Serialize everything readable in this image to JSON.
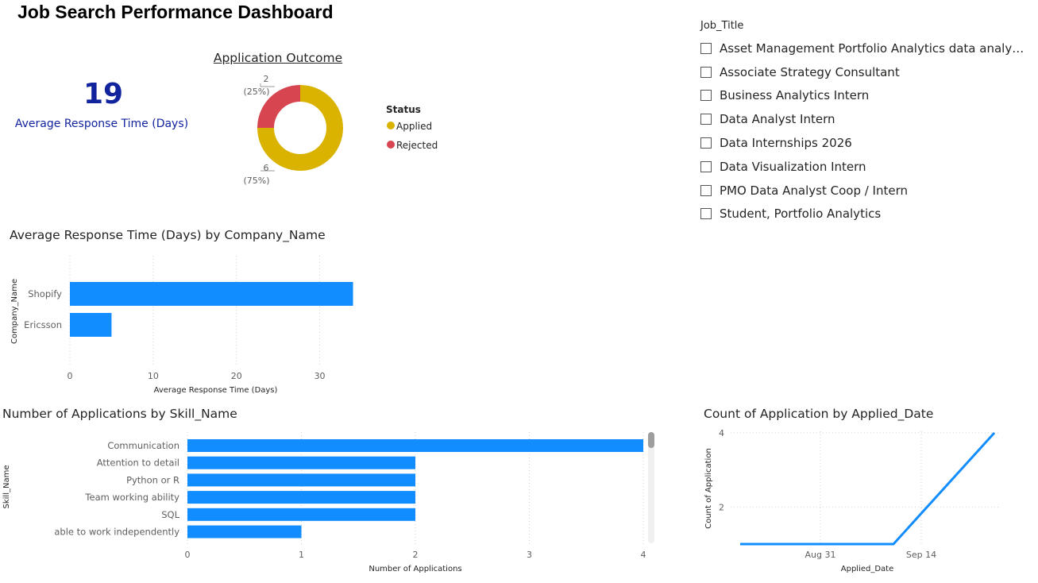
{
  "dashboard": {
    "title": "Job Search Performance Dashboard"
  },
  "kpi": {
    "value": "19",
    "label": "Average Response Time (Days)"
  },
  "donut": {
    "title": "Application Outcome",
    "legend_title": "Status",
    "colors": {
      "Applied": "#d9b300",
      "Rejected": "#d64550"
    },
    "labels": {
      "rejected_count": "2",
      "rejected_pct": "(25%)",
      "applied_count": "6",
      "applied_pct": "(75%)"
    }
  },
  "slicer": {
    "header": "Job_Title",
    "items": [
      "Asset Management Portfolio Analytics data analyst i...",
      "Associate Strategy Consultant",
      "Business Analytics Intern",
      "Data Analyst Intern",
      "Data Internships 2026",
      "Data Visualization Intern",
      "PMO Data Analyst Coop / Intern",
      "Student, Portfolio Analytics"
    ]
  },
  "company_chart": {
    "title": "Average Response Time (Days) by Company_Name"
  },
  "skill_chart": {
    "title": "Number of Applications by Skill_Name"
  },
  "date_chart": {
    "title": "Count of Application by Applied_Date"
  },
  "chart_data": [
    {
      "type": "pie",
      "title": "Application Outcome",
      "categories": [
        "Applied",
        "Rejected"
      ],
      "values": [
        6,
        2
      ],
      "percent_labels": [
        "(75%)",
        "(25%)"
      ],
      "legend": "right",
      "colors": [
        "#d9b300",
        "#d64550"
      ]
    },
    {
      "type": "bar",
      "orientation": "horizontal",
      "title": "Average Response Time (Days) by Company_Name",
      "categories": [
        "Shopify",
        "Ericsson"
      ],
      "values": [
        34,
        5
      ],
      "xlabel": "Average Response Time (Days)",
      "ylabel": "Company_Name",
      "xlim": [
        0,
        35
      ],
      "xticks": [
        0,
        10,
        20,
        30
      ],
      "grid": true,
      "color": "#118dff"
    },
    {
      "type": "bar",
      "orientation": "horizontal",
      "title": "Number of Applications by Skill_Name",
      "categories": [
        "Communication",
        "Attention to detail",
        "Python or R",
        "Team working ability",
        "SQL",
        "able to work independently"
      ],
      "values": [
        4,
        2,
        2,
        2,
        2,
        1
      ],
      "xlabel": "Number of Applications",
      "ylabel": "Skill_Name",
      "xlim": [
        0,
        4
      ],
      "xticks": [
        0,
        1,
        2,
        3,
        4
      ],
      "grid": true,
      "color": "#118dff"
    },
    {
      "type": "line",
      "title": "Count of Application by Applied_Date",
      "x": [
        "Aug 21",
        "Sep 13",
        "Sep 23"
      ],
      "values": [
        1,
        1,
        4
      ],
      "xticks": [
        "Aug 31",
        "Sep 14"
      ],
      "yticks": [
        2,
        4
      ],
      "xlabel": "Applied_Date",
      "ylabel": "Count of Application",
      "grid": true,
      "color": "#118dff"
    }
  ]
}
